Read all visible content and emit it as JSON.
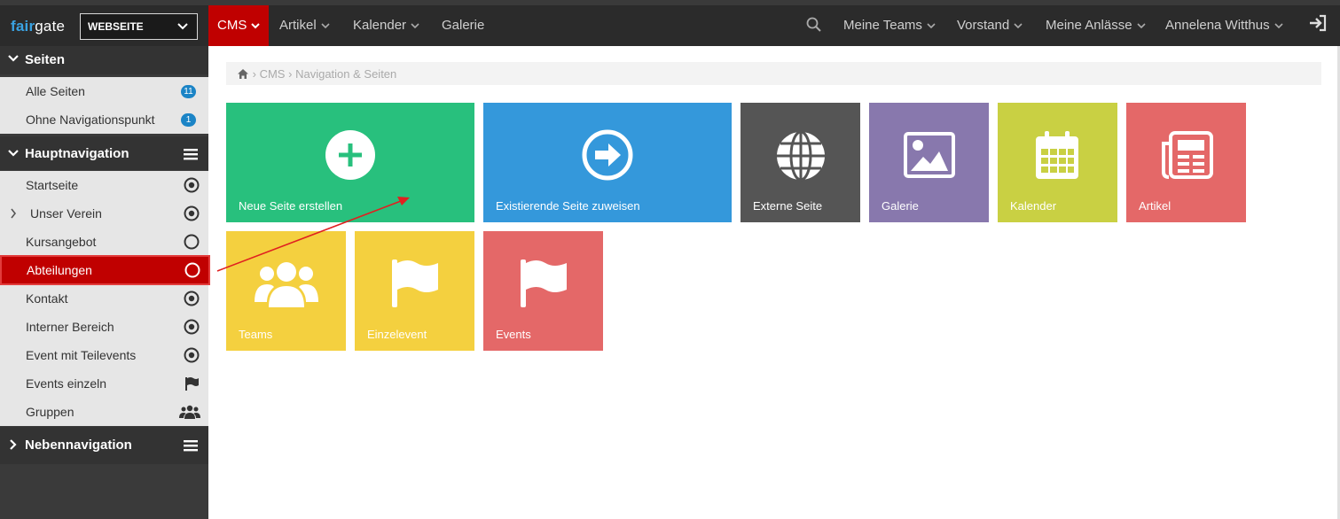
{
  "header": {
    "logo_fair": "fair",
    "logo_gate": "gate",
    "site_select_value": "WEBSEITE",
    "nav": [
      {
        "label": "CMS"
      },
      {
        "label": "Artikel"
      },
      {
        "label": "Kalender"
      },
      {
        "label": "Galerie"
      }
    ],
    "right_nav": [
      {
        "label": "Meine Teams"
      },
      {
        "label": "Vorstand"
      },
      {
        "label": "Meine Anlässe"
      },
      {
        "label": "Annelena Witthus"
      }
    ],
    "icons": {
      "search": "search-icon",
      "logout": "sign-in-icon"
    }
  },
  "sidebar": {
    "sections": [
      {
        "title": "Seiten",
        "items": [
          {
            "label": "Alle Seiten",
            "badge": "11"
          },
          {
            "label": "Ohne Navigationspunkt",
            "badge": "1"
          }
        ]
      },
      {
        "title": "Hauptnavigation",
        "items": [
          {
            "label": "Startseite",
            "icon": "dot-circle-icon"
          },
          {
            "label": "Unser Verein",
            "icon": "dot-circle-icon"
          },
          {
            "label": "Kursangebot",
            "icon": "circle-icon"
          },
          {
            "label": "Abteilungen",
            "icon": "circle-icon"
          },
          {
            "label": "Kontakt",
            "icon": "dot-circle-icon"
          },
          {
            "label": "Interner Bereich",
            "icon": "dot-circle-icon"
          },
          {
            "label": "Event mit Teilevents",
            "icon": "dot-circle-icon"
          },
          {
            "label": "Events einzeln",
            "icon": "flag-icon"
          },
          {
            "label": "Gruppen",
            "icon": "users-icon"
          }
        ]
      },
      {
        "title": "Nebennavigation",
        "items": []
      }
    ]
  },
  "breadcrumb": {
    "home_icon": "home-icon",
    "items": [
      "CMS",
      "Navigation & Seiten"
    ]
  },
  "tiles": [
    {
      "label": "Neue Seite erstellen",
      "color": "#28c07d",
      "icon": "plus-circle-icon"
    },
    {
      "label": "Existierende Seite zuweisen",
      "color": "#3498db",
      "icon": "arrow-circle-right-icon"
    },
    {
      "label": "Externe Seite",
      "color": "#555555",
      "icon": "globe-icon"
    },
    {
      "label": "Galerie",
      "color": "#8878ad",
      "icon": "image-icon"
    },
    {
      "label": "Kalender",
      "color": "#c9d043",
      "icon": "calendar-icon"
    },
    {
      "label": "Artikel",
      "color": "#e46868",
      "icon": "newspaper-icon"
    },
    {
      "label": "Teams",
      "color": "#f4d03f",
      "icon": "users-icon"
    },
    {
      "label": "Einzelevent",
      "color": "#f4d03f",
      "icon": "flag-icon"
    },
    {
      "label": "Events",
      "color": "#e46868",
      "icon": "flag-icon"
    }
  ],
  "colors": {
    "accent": "#c00000",
    "annotation_arrow": "#e02020"
  }
}
